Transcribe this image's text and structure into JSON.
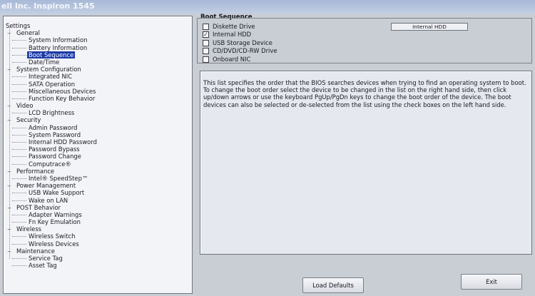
{
  "window": {
    "title": "ell Inc. Inspiron 1545"
  },
  "tree": {
    "root": "Settings",
    "categories": [
      {
        "label": "General",
        "toggle": "−",
        "items": [
          "System Information",
          "Battery Information",
          "Boot Sequence",
          "Date/Time"
        ]
      },
      {
        "label": "System Configuration",
        "toggle": "−",
        "items": [
          "Integrated NIC",
          "SATA Operation",
          "Miscellaneous Devices",
          "Function Key Behavior"
        ]
      },
      {
        "label": "Video",
        "toggle": "−",
        "items": [
          "LCD Brightness"
        ]
      },
      {
        "label": "Security",
        "toggle": "−",
        "items": [
          "Admin Password",
          "System Password",
          "Internal HDD Password",
          "Password Bypass",
          "Password Change",
          "Computrace®"
        ]
      },
      {
        "label": "Performance",
        "toggle": "−",
        "items": [
          "Intel® SpeedStep™"
        ]
      },
      {
        "label": "Power Management",
        "toggle": "−",
        "items": [
          "USB Wake Support",
          "Wake on LAN"
        ]
      },
      {
        "label": "POST Behavior",
        "toggle": "−",
        "items": [
          "Adapter Warnings",
          "Fn Key Emulation"
        ]
      },
      {
        "label": "Wireless",
        "toggle": "−",
        "items": [
          "Wireless Switch",
          "Wireless Devices"
        ]
      },
      {
        "label": "Maintenance",
        "toggle": "−",
        "items": [
          "Service Tag",
          "Asset Tag"
        ]
      }
    ]
  },
  "boot_sequence": {
    "title": "Boot Sequence",
    "devices": [
      {
        "label": "Diskette Drive",
        "mark": ""
      },
      {
        "label": "Internal HDD",
        "mark": "✓"
      },
      {
        "label": "USB Storage Device",
        "mark": ""
      },
      {
        "label": "CD/DVD/CD-RW Drive",
        "mark": ""
      },
      {
        "label": "Onboard NIC",
        "mark": ""
      }
    ],
    "order_list": [
      "Internal HDD"
    ]
  },
  "description": "This list specifies the order that the BIOS searches devices when trying to find an operating system to boot. To change the boot order select the device to be changed in the list on the right hand side, then click up/down arrows or use the keyboard PgUp/PgDn keys to change the boot order of the device. The boot devices can also be selected or de-selected from the list using the check boxes on the left hand side.",
  "buttons": {
    "load_defaults": "Load Defaults",
    "exit": "Exit"
  }
}
